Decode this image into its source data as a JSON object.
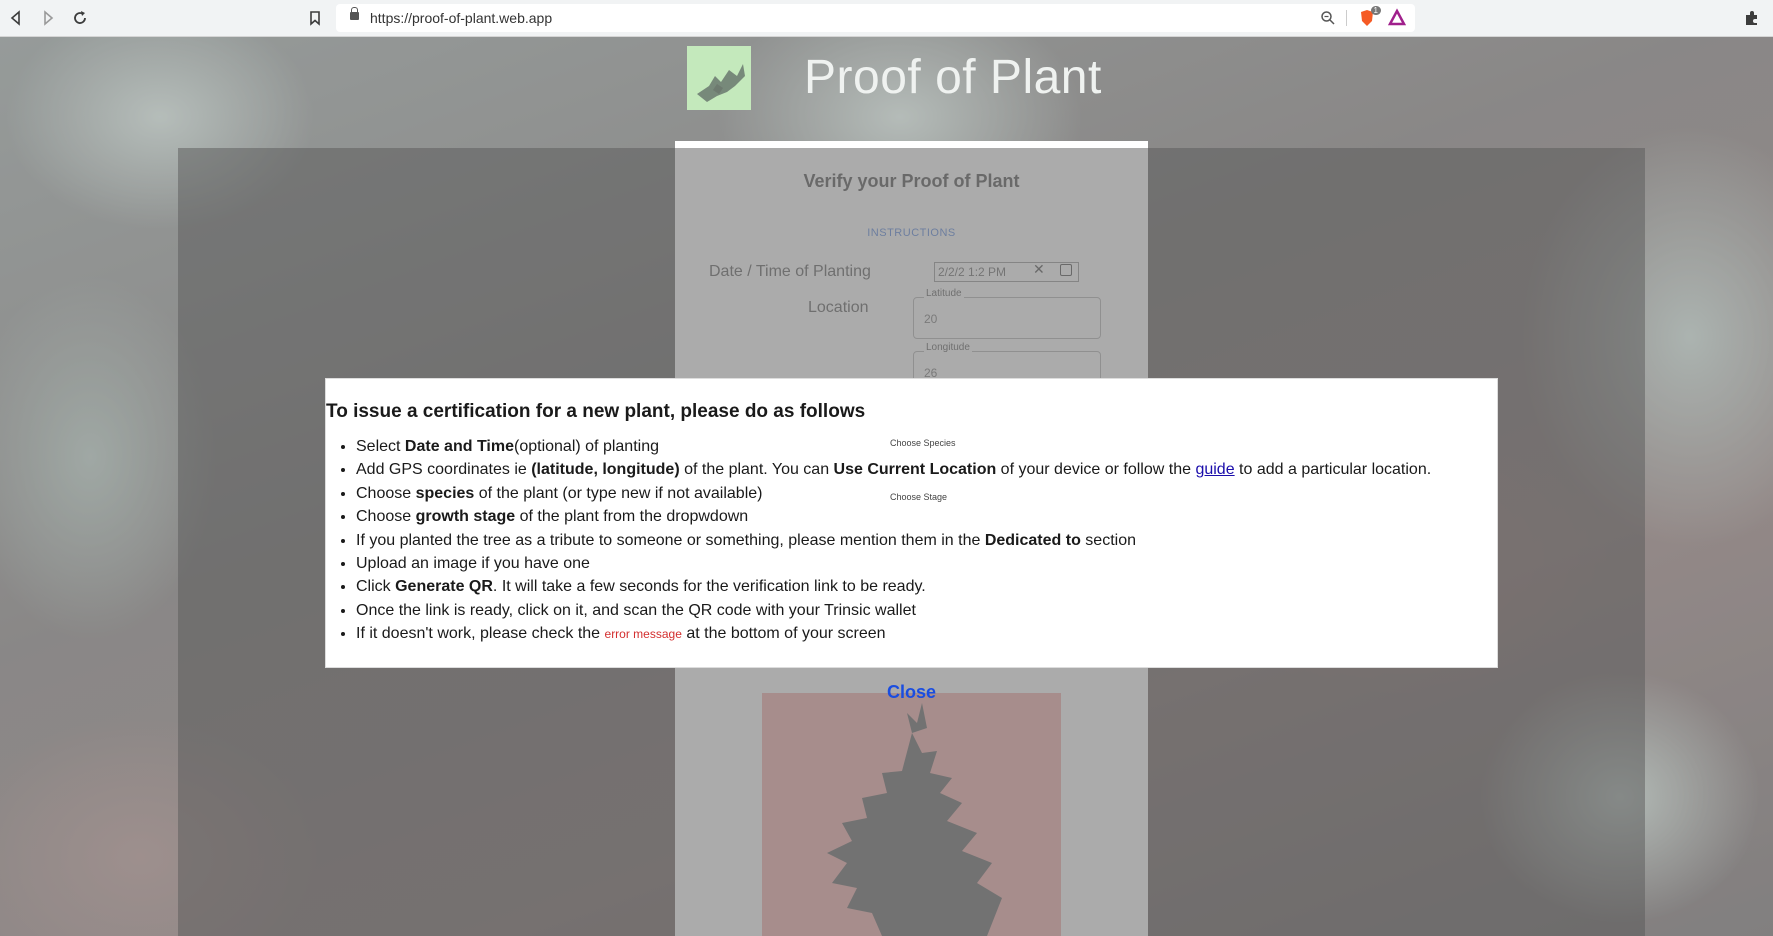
{
  "browser": {
    "url": "https://proof-of-plant.web.app",
    "shield_badge": "1"
  },
  "header": {
    "title": "Proof of Plant"
  },
  "card": {
    "title": "Verify your Proof of Plant",
    "instructions_link": "INSTRUCTIONS",
    "date_label": "Date / Time of Planting",
    "date_value": "2/2/2 1:2  PM",
    "location_label": "Location",
    "latitude_label": "Latitude",
    "latitude_value": "20",
    "longitude_label": "Longitude",
    "longitude_value": "26",
    "close_label": "Close"
  },
  "modal": {
    "title": "To issue a certification for a new plant, please do as follows",
    "floating_choose_species": "Choose Species",
    "floating_choose_stage": "Choose Stage",
    "steps": [
      {
        "a": "Select ",
        "b": "Date and Time",
        "c": "(optional) of planting"
      },
      {
        "a": "Add GPS coordinates ie ",
        "b": "(latitude, longitude)",
        "c": " of the plant. You can ",
        "d": "Use Current Location",
        "e": " of your device or follow the ",
        "link": "guide",
        "f": " to add a particular location."
      },
      {
        "a": "Choose ",
        "b": "species",
        "c": " of the plant (or type new if not available)"
      },
      {
        "a": "Choose ",
        "b": "growth stage",
        "c": " of the plant from the dropwdown"
      },
      {
        "a": "If you planted the tree as a tribute to someone or something, please mention them in the ",
        "b": "Dedicated to",
        "c": " section"
      },
      {
        "a": "Upload an image if you have one"
      },
      {
        "a": "Click ",
        "b": "Generate QR",
        "c": ". It will take a few seconds for the verification link to be ready."
      },
      {
        "a": "Once the link is ready, click on it, and scan the QR code with your Trinsic wallet"
      },
      {
        "a": "If it doesn't work, please check the ",
        "err": "error message",
        "c": " at the bottom of your screen"
      }
    ]
  },
  "colors": {
    "link": "#1a0dab",
    "error": "#d32f2f",
    "close": "#1a4de0"
  }
}
